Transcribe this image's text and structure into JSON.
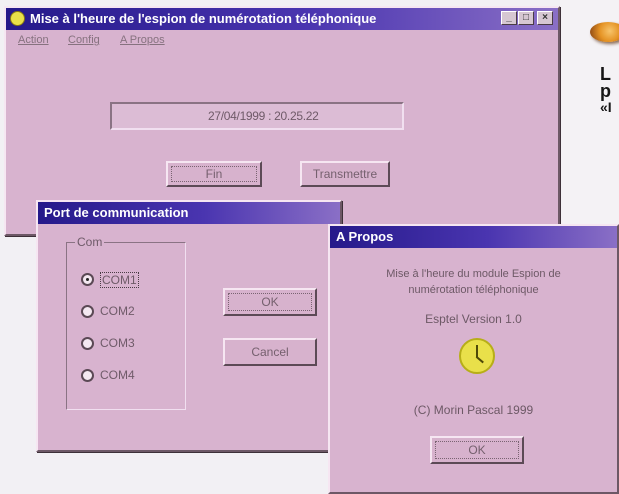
{
  "main_window": {
    "title": "Mise à l'heure de l'espion de numérotation téléphonique",
    "menu": [
      "Action",
      "Config",
      "A Propos"
    ],
    "datetime": "27/04/1999 : 20.25.22",
    "buttons": {
      "fin": "Fin",
      "transmettre": "Transmettre"
    },
    "title_buttons": {
      "minimize": "_",
      "maximize": "□",
      "close": "×"
    }
  },
  "port_window": {
    "title": "Port de communication",
    "group_label": "Com",
    "options": [
      "COM1",
      "COM2",
      "COM3",
      "COM4"
    ],
    "selected_option": "COM1",
    "buttons": {
      "ok": "OK",
      "cancel": "Cancel"
    }
  },
  "about_window": {
    "title": "A Propos",
    "description_line1": "Mise à l'heure du module Espion de",
    "description_line2": "numérotation téléphonique",
    "version": "Esptel Version 1.0",
    "copyright": "(C) Morin Pascal 1999",
    "ok_label": "OK"
  },
  "magazine_text": {
    "line1": "L",
    "line2": "p",
    "line3": "«I"
  },
  "colors": {
    "window_bg": "#d8b3cf",
    "titlebar_start": "#25198a",
    "titlebar_end": "#8a6fc6",
    "clock_yellow": "#e9e04a",
    "logo_orange": "#e59324"
  }
}
